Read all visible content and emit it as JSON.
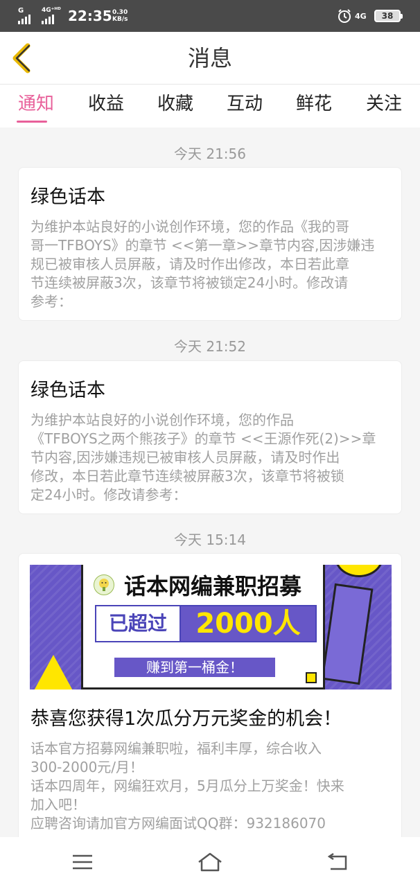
{
  "status_bar": {
    "net1": "G",
    "net2": "4G⁺ᴴᴰ",
    "time": "22:35",
    "speed_value": "0.30",
    "speed_unit": "KB/s",
    "net3": "4G",
    "battery": "38"
  },
  "header": {
    "title": "消息",
    "back_icon": "chevron-left-icon"
  },
  "tabs": [
    {
      "label": "通知",
      "active": true
    },
    {
      "label": "收益",
      "active": false
    },
    {
      "label": "收藏",
      "active": false
    },
    {
      "label": "互动",
      "active": false
    },
    {
      "label": "鲜花",
      "active": false
    },
    {
      "label": "关注",
      "active": false
    }
  ],
  "messages": [
    {
      "timestamp": "今天 21:56",
      "title": "绿色话本",
      "body": [
        "为维护本站良好的小说创作环境，您的作品《我的哥",
        "哥一TFBOYS》的章节 <<第一章>>章节内容,因涉嫌违",
        "规已被审核人员屏蔽，请及时作出修改，本日若此章",
        "节连续被屏蔽3次，该章节将被锁定24小时。修改请",
        "参考："
      ]
    },
    {
      "timestamp": "今天 21:52",
      "title": "绿色话本",
      "body": [
        "为维护本站良好的小说创作环境，您的作品",
        "《TFBOYS之两个熊孩子》的章节 <<王源作死(2)>>章",
        "节内容,因涉嫌违规已被审核人员屏蔽，请及时作出",
        "修改，本日若此章节连续被屏蔽3次，该章节将被锁",
        "定24小时。修改请参考："
      ]
    },
    {
      "timestamp": "今天 15:14",
      "banner": {
        "headline": "话本网编兼职招募",
        "left_box": "已超过",
        "right_box": "2000人",
        "earn": "赚到第一桶金！"
      },
      "title": "恭喜您获得1次瓜分万元奖金的机会！",
      "body": [
        "话本官方招募网编兼职啦，福利丰厚，综合收入",
        "300-2000元/月！",
        "话本四周年，网编狂欢月，5月瓜分上万奖金！快来",
        "加入吧！",
        "应聘咨询请加官方网编面试QQ群：932186070"
      ]
    }
  ],
  "navbar": {
    "menu_icon": "menu-icon",
    "home_icon": "home-icon",
    "back_icon": "back-arrow-icon"
  },
  "colors": {
    "accent": "#e8609a",
    "status_bar": "#4a4a4a",
    "banner_purple": "#6757c7",
    "banner_yellow": "#ffe600"
  }
}
